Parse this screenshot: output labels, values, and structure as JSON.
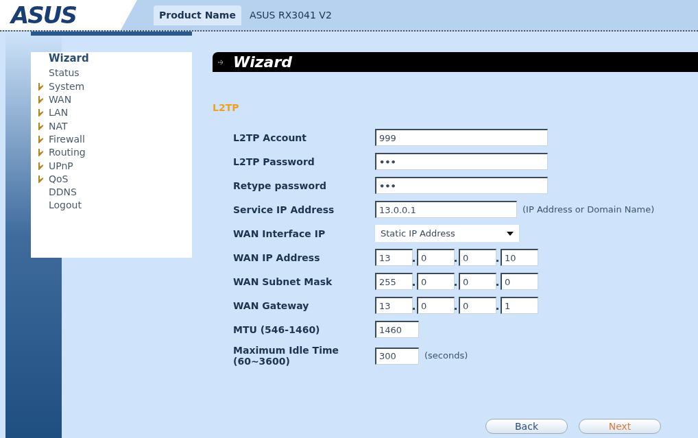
{
  "header": {
    "logo": "ASUS",
    "product_label": "Product Name",
    "product_value": "ASUS RX3041 V2"
  },
  "sidebar": {
    "items": [
      {
        "label": "Wizard",
        "selected": true,
        "has_submenu": false
      },
      {
        "label": "Status",
        "selected": false,
        "has_submenu": false
      },
      {
        "label": "System",
        "selected": false,
        "has_submenu": true
      },
      {
        "label": "WAN",
        "selected": false,
        "has_submenu": true
      },
      {
        "label": "LAN",
        "selected": false,
        "has_submenu": true
      },
      {
        "label": "NAT",
        "selected": false,
        "has_submenu": true
      },
      {
        "label": "Firewall",
        "selected": false,
        "has_submenu": true
      },
      {
        "label": "Routing",
        "selected": false,
        "has_submenu": true
      },
      {
        "label": "UPnP",
        "selected": false,
        "has_submenu": true
      },
      {
        "label": "QoS",
        "selected": false,
        "has_submenu": true
      },
      {
        "label": "DDNS",
        "selected": false,
        "has_submenu": false
      },
      {
        "label": "Logout",
        "selected": false,
        "has_submenu": false
      }
    ]
  },
  "page": {
    "title": "Wizard",
    "section": "L2TP"
  },
  "form": [
    {
      "kind": "text",
      "label": "L2TP Account",
      "value": "999"
    },
    {
      "kind": "password",
      "label": "L2TP Password",
      "value": "•••"
    },
    {
      "kind": "password",
      "label": "Retype password",
      "value": "•••"
    },
    {
      "kind": "medium",
      "label": "Service IP Address",
      "value": "13.0.0.1",
      "hint": "(IP Address or Domain Name)"
    },
    {
      "kind": "select",
      "label": "WAN Interface IP",
      "value": "Static IP Address"
    },
    {
      "kind": "ip",
      "label": "WAN IP Address",
      "octets": [
        "13",
        "0",
        "0",
        "10"
      ]
    },
    {
      "kind": "ip",
      "label": "WAN Subnet Mask",
      "octets": [
        "255",
        "0",
        "0",
        "0"
      ]
    },
    {
      "kind": "ip",
      "label": "WAN Gateway",
      "octets": [
        "13",
        "0",
        "0",
        "1"
      ]
    },
    {
      "kind": "small",
      "label": "MTU (546-1460)",
      "value": "1460"
    },
    {
      "kind": "small",
      "label": "Maximum Idle Time (60~3600)",
      "value": "300",
      "hint": "(seconds)"
    }
  ],
  "buttons": [
    {
      "label": "Back",
      "kind": "secondary"
    },
    {
      "label": "Next",
      "kind": "primary"
    }
  ]
}
